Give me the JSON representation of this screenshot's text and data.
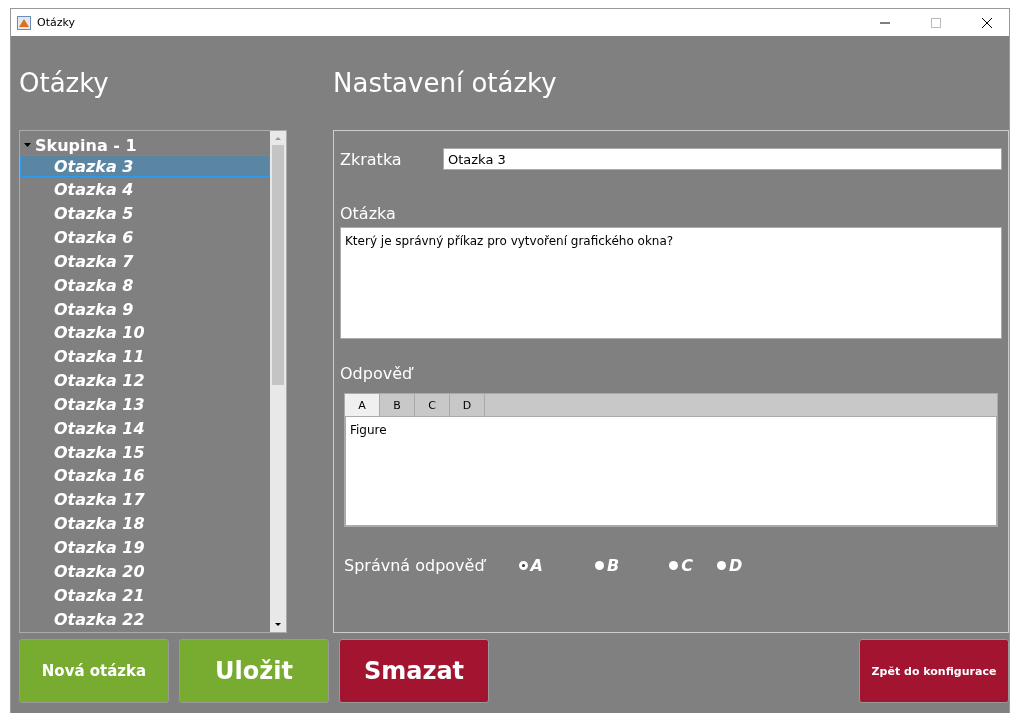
{
  "window": {
    "title": "Otázky"
  },
  "left": {
    "heading": "Otázky"
  },
  "tree": [
    {
      "label": "Skupina - 1",
      "expanded": true,
      "children": [
        {
          "label": "Otazka 3",
          "selected": true
        },
        {
          "label": "Otazka 4",
          "selected": false
        },
        {
          "label": "Otazka 5",
          "selected": false
        },
        {
          "label": "Otazka 6",
          "selected": false
        },
        {
          "label": "Otazka 7",
          "selected": false
        },
        {
          "label": "Otazka 8",
          "selected": false
        },
        {
          "label": "Otazka 9",
          "selected": false
        },
        {
          "label": "Otazka 10",
          "selected": false
        },
        {
          "label": "Otazka 11",
          "selected": false
        },
        {
          "label": "Otazka 12",
          "selected": false
        },
        {
          "label": "Otazka 13",
          "selected": false
        },
        {
          "label": "Otazka 14",
          "selected": false
        },
        {
          "label": "Otazka 15",
          "selected": false
        },
        {
          "label": "Otazka 16",
          "selected": false
        },
        {
          "label": "Otazka 17",
          "selected": false
        },
        {
          "label": "Otazka 18",
          "selected": false
        },
        {
          "label": "Otazka 19",
          "selected": false
        },
        {
          "label": "Otazka 20",
          "selected": false
        },
        {
          "label": "Otazka 21",
          "selected": false
        },
        {
          "label": "Otazka 22",
          "selected": false
        }
      ]
    }
  ],
  "right": {
    "heading": "Nastavení otázky"
  },
  "form": {
    "shortcut_label": "Zkratka",
    "shortcut_value": "Otazka 3",
    "question_label": "Otázka",
    "question_value": "Který je správný příkaz pro vytvoření grafického okna?",
    "answer_label": "Odpověď"
  },
  "answer_tabs": [
    {
      "label": "A",
      "selected": true
    },
    {
      "label": "B",
      "selected": false
    },
    {
      "label": "C",
      "selected": false
    },
    {
      "label": "D",
      "selected": false
    }
  ],
  "answer_value": "Figure",
  "correct": {
    "label": "Správná odpověď",
    "options": [
      {
        "label": "A",
        "selected": true
      },
      {
        "label": "B",
        "selected": false
      },
      {
        "label": "C",
        "selected": false
      },
      {
        "label": "D",
        "selected": false
      }
    ]
  },
  "buttons": [
    {
      "label": "Nová otázka",
      "kind": "green"
    },
    {
      "label": "Uložit",
      "kind": "green"
    },
    {
      "label": "Smazat",
      "kind": "red"
    },
    {
      "label": "Zpět do konfigurace",
      "kind": "red"
    }
  ]
}
